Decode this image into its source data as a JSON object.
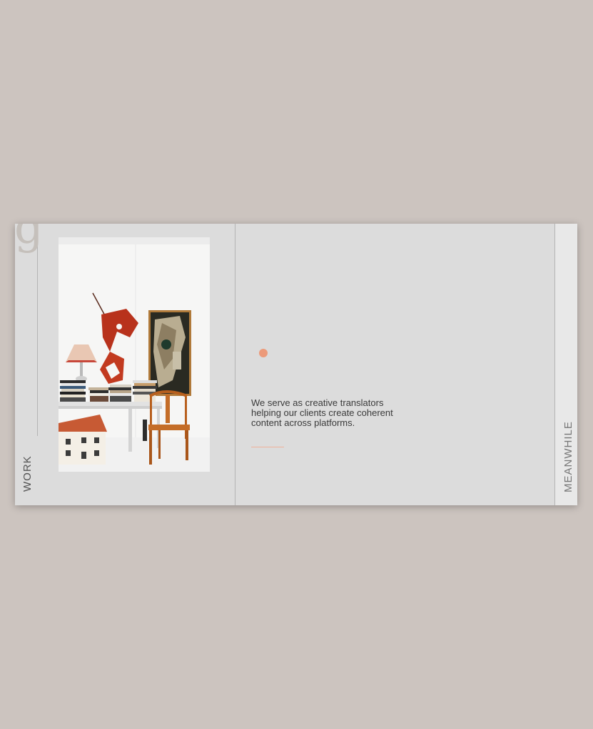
{
  "brand": {
    "logo_letter": "g"
  },
  "nav": {
    "left_label": "WORK",
    "right_label": "MEANWHILE"
  },
  "hero": {
    "tagline": "We serve as creative translators helping our clients create coherent content across platforms."
  },
  "colors": {
    "page_background": "#ccc4bf",
    "card_background": "#dcdcdc",
    "accent": "#ec9a7a"
  },
  "image": {
    "icon": "interior-photo-icon"
  }
}
